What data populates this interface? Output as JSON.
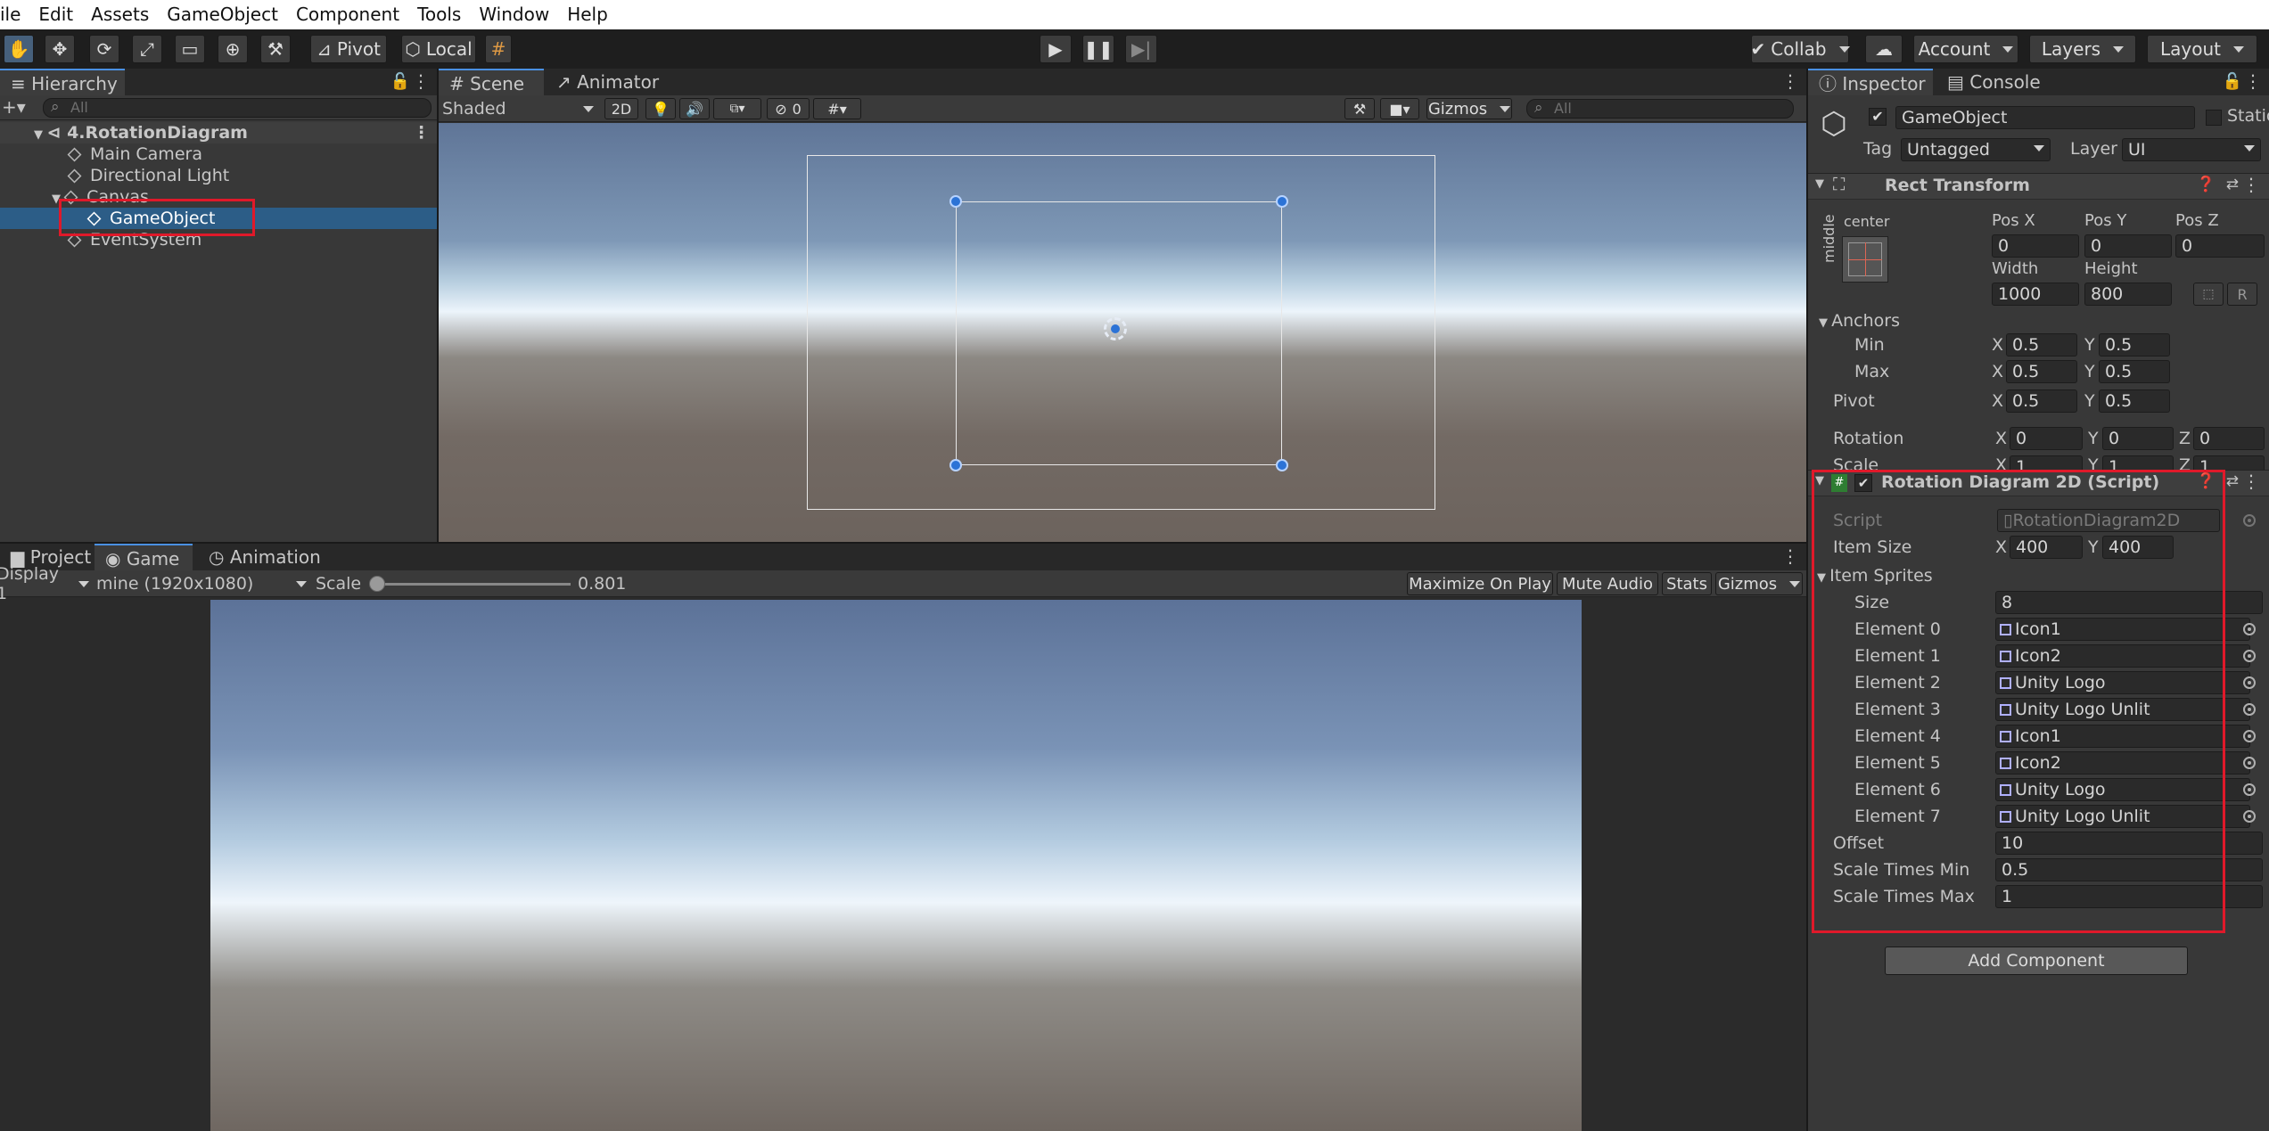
{
  "menu": [
    "ile",
    "Edit",
    "Assets",
    "GameObject",
    "Component",
    "Tools",
    "Window",
    "Help"
  ],
  "toolbar": {
    "pivot": "Pivot",
    "local": "Local",
    "collab": "Collab",
    "account": "Account",
    "layers": "Layers",
    "layout": "Layout"
  },
  "hierarchy": {
    "tab": "Hierarchy",
    "search_placeholder": "All",
    "scene": "4.RotationDiagram",
    "items": [
      "Main Camera",
      "Directional Light",
      "Canvas",
      "GameObject",
      "EventSystem"
    ]
  },
  "scene_view": {
    "tabs": [
      "Scene",
      "Animator"
    ],
    "shading": "Shaded",
    "mode_2d": "2D",
    "hidden_count": "0",
    "gizmos": "Gizmos",
    "search_placeholder": "All"
  },
  "game_view": {
    "tabs": [
      "Project",
      "Game",
      "Animation"
    ],
    "display": "Display 1",
    "resolution": "mine (1920x1080)",
    "scale_label": "Scale",
    "scale_value": "0.801",
    "scale_fraction": 0.0,
    "buttons": [
      "Maximize On Play",
      "Mute Audio",
      "Stats",
      "Gizmos"
    ]
  },
  "inspector": {
    "tabs": [
      "Inspector",
      "Console"
    ],
    "object_name": "GameObject",
    "static_label": "Static",
    "tag_label": "Tag",
    "tag_value": "Untagged",
    "layer_label": "Layer",
    "layer_value": "UI",
    "rect_transform": {
      "title": "Rect Transform",
      "anchor_h": "center",
      "anchor_v": "middle",
      "pos_labels": [
        "Pos X",
        "Pos Y",
        "Pos Z"
      ],
      "pos_values": [
        "0",
        "0",
        "0"
      ],
      "width_label": "Width",
      "height_label": "Height",
      "width": "1000",
      "height": "800",
      "r_btn": "R",
      "anchors_label": "Anchors",
      "min_label": "Min",
      "max_label": "Max",
      "min": [
        "0.5",
        "0.5"
      ],
      "max": [
        "0.5",
        "0.5"
      ],
      "pivot_label": "Pivot",
      "pivot": [
        "0.5",
        "0.5"
      ],
      "rotation_label": "Rotation",
      "rotation": [
        "0",
        "0",
        "0"
      ],
      "scale_label": "Scale",
      "scale": [
        "1",
        "1",
        "1"
      ],
      "axis": [
        "X",
        "Y",
        "Z"
      ]
    },
    "script_component": {
      "title": "Rotation Diagram 2D (Script)",
      "script_label": "Script",
      "script_value": "RotationDiagram2D",
      "item_size_label": "Item Size",
      "item_size": [
        "400",
        "400"
      ],
      "item_sprites_label": "Item Sprites",
      "size_label": "Size",
      "size_value": "8",
      "elements": [
        {
          "label": "Element 0",
          "value": "Icon1"
        },
        {
          "label": "Element 1",
          "value": "Icon2"
        },
        {
          "label": "Element 2",
          "value": "Unity Logo"
        },
        {
          "label": "Element 3",
          "value": "Unity Logo Unlit"
        },
        {
          "label": "Element 4",
          "value": "Icon1"
        },
        {
          "label": "Element 5",
          "value": "Icon2"
        },
        {
          "label": "Element 6",
          "value": "Unity Logo"
        },
        {
          "label": "Element 7",
          "value": "Unity Logo Unlit"
        }
      ],
      "offset_label": "Offset",
      "offset": "10",
      "scale_min_label": "Scale Times Min",
      "scale_min": "0.5",
      "scale_max_label": "Scale Times Max",
      "scale_max": "1"
    },
    "add_component": "Add Component"
  },
  "colors": {
    "accent": "#2c5d87",
    "highlight": "#e0192a",
    "panel": "#383838"
  }
}
